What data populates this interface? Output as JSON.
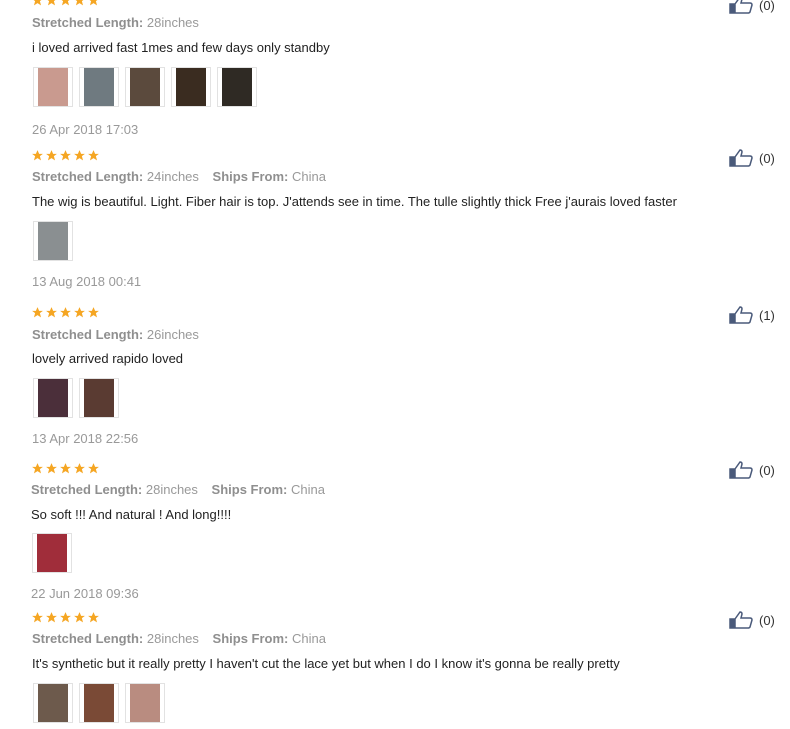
{
  "labels": {
    "stretched_length": "Stretched Length:",
    "ships_from": "Ships From:"
  },
  "colors": {
    "star": "#f5a623",
    "like_icon": "#4a5a7a"
  },
  "reviews": [
    {
      "rating": 5,
      "length": "28inches",
      "ships_from": "",
      "text": "i loved arrived fast 1mes and few days only standby",
      "likes": "(0)",
      "photos": [
        {
          "tone": "#c99a8f"
        },
        {
          "tone": "#6f7a80"
        },
        {
          "tone": "#5b4a3d"
        },
        {
          "tone": "#3a2c20"
        },
        {
          "tone": "#2f2a24"
        }
      ],
      "date": "26 Apr 2018 17:03"
    },
    {
      "rating": 5,
      "length": "24inches",
      "ships_from": "China",
      "text": "The wig is beautiful. Light. Fiber hair is top. J'attends see in time. The tulle slightly thick Free j'aurais loved faster",
      "likes": "(0)",
      "photos": [
        {
          "tone": "#8a8f91"
        }
      ],
      "date": "13 Aug 2018 00:41"
    },
    {
      "rating": 5,
      "length": "26inches",
      "ships_from": "",
      "text": "lovely arrived rapido loved",
      "likes": "(1)",
      "photos": [
        {
          "tone": "#4b2f3a"
        },
        {
          "tone": "#5a3b32"
        }
      ],
      "date": "13 Apr 2018 22:56"
    },
    {
      "rating": 5,
      "length": "28inches",
      "ships_from": "China",
      "text": "So soft !!! And natural ! And long!!!!",
      "likes": "(0)",
      "photos": [
        {
          "tone": "#a02d3a"
        }
      ],
      "date": "22 Jun 2018 09:36"
    },
    {
      "rating": 5,
      "length": "28inches",
      "ships_from": "China",
      "text": "It's synthetic but it really pretty I haven't cut the lace yet but when I do I know it's gonna be really pretty",
      "likes": "(0)",
      "photos": [
        {
          "tone": "#6d5a4c"
        },
        {
          "tone": "#7a4a36"
        },
        {
          "tone": "#b98c80"
        }
      ],
      "date": ""
    }
  ]
}
